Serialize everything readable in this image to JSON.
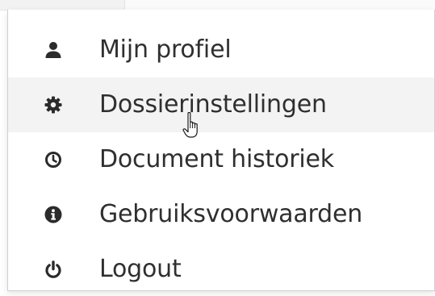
{
  "menu": {
    "items": [
      {
        "label": "Mijn profiel",
        "icon": "user-icon"
      },
      {
        "label": "Dossierinstellingen",
        "icon": "cog-icon"
      },
      {
        "label": "Document historiek",
        "icon": "clock-icon"
      },
      {
        "label": "Gebruiksvoorwaarden",
        "icon": "info-icon"
      },
      {
        "label": "Logout",
        "icon": "power-icon"
      }
    ],
    "active_index": 1
  },
  "cursor": {
    "icon": "hand-pointer-cursor-icon"
  },
  "colors": {
    "text": "#2f2f2f",
    "icon": "#2b2b2b",
    "hover_background": "#f3f3f3",
    "border": "#cfcfcf"
  }
}
